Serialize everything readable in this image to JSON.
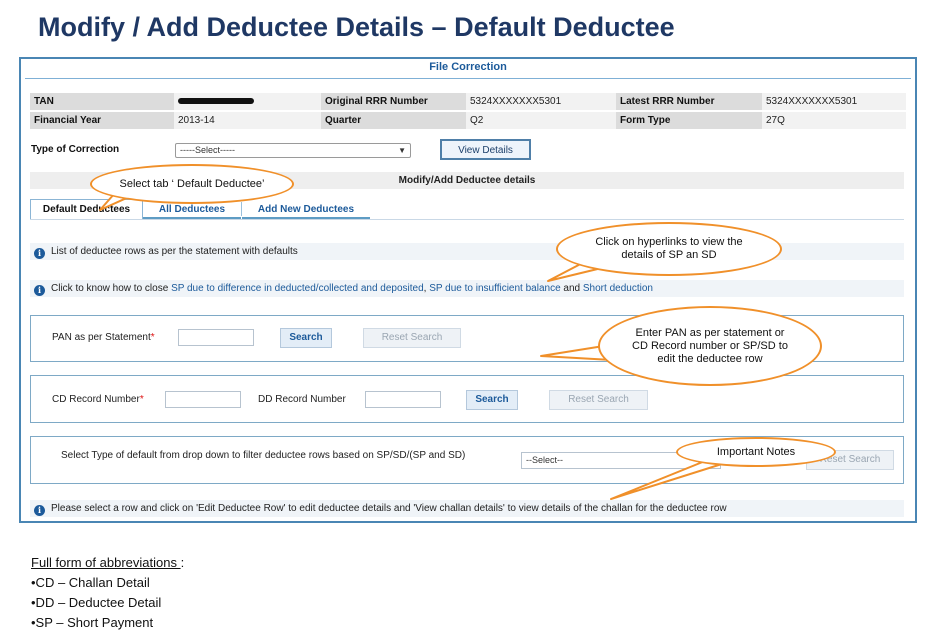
{
  "slide": {
    "title": "Modify / Add Deductee Details – Default Deductee"
  },
  "frame": {
    "title": "File Correction"
  },
  "info": {
    "tan_label": "TAN",
    "tan_value": "",
    "orig_rrr_label": "Original RRR Number",
    "orig_rrr_value": "5324XXXXXXX5301",
    "latest_rrr_label": "Latest RRR Number",
    "latest_rrr_value": "5324XXXXXXX5301",
    "fy_label": "Financial Year",
    "fy_value": "2013-14",
    "quarter_label": "Quarter",
    "quarter_value": "Q2",
    "form_type_label": "Form Type",
    "form_type_value": "27Q"
  },
  "correction": {
    "type_label": "Type of Correction",
    "type_value": "-----Select-----",
    "view_details_label": "View Details"
  },
  "section": {
    "title": "Modify/Add Deductee details"
  },
  "tabs": [
    "Default Deductees",
    "All Deductees",
    "Add New Deductees"
  ],
  "notes": {
    "list_note": "List of deductee rows as per the statement with defaults",
    "close_prefix": "Click to know how to close ",
    "link1": "SP due to difference in deducted/collected and deposited",
    "sep1": ", ",
    "link2": "SP due to insufficient balance",
    "sep2": " and ",
    "link3": "Short deduction",
    "bottom_note": "Please select a row and click on 'Edit Deductee Row' to edit deductee details and 'View challan details' to view details of the challan for the deductee row"
  },
  "pan_panel": {
    "label": "PAN as per Statement",
    "required_mark": "*",
    "search_label": "Search",
    "reset_label": "Reset Search"
  },
  "cd_panel": {
    "cd_label": "CD Record Number",
    "required_mark": "*",
    "dd_label": "DD Record Number",
    "search_label": "Search",
    "reset_label": "Reset Search"
  },
  "filter_panel": {
    "label": "Select Type of default from drop down to filter deductee rows based on SP/SD/(SP and SD)",
    "select_value": "--Select--",
    "reset_label": "Reset Search"
  },
  "callouts": {
    "tab_hint": "Select tab ‘ Default Deductee’",
    "links_hint": "Click on hyperlinks to view the details of SP an SD",
    "pan_hint": "Enter PAN as per statement or CD Record number or SP/SD to edit the deductee row",
    "notes_hint": "Important Notes"
  },
  "abbreviations": {
    "heading": "Full form of abbreviations ",
    "colon": ":",
    "items": [
      "•CD – Challan Detail",
      "•DD – Deductee Detail",
      "•SP – Short Payment"
    ]
  },
  "colors": {
    "title": "#1f3864",
    "accent": "#1c5a9a",
    "callout": "#f0902a",
    "frame": "#4a86b4"
  }
}
